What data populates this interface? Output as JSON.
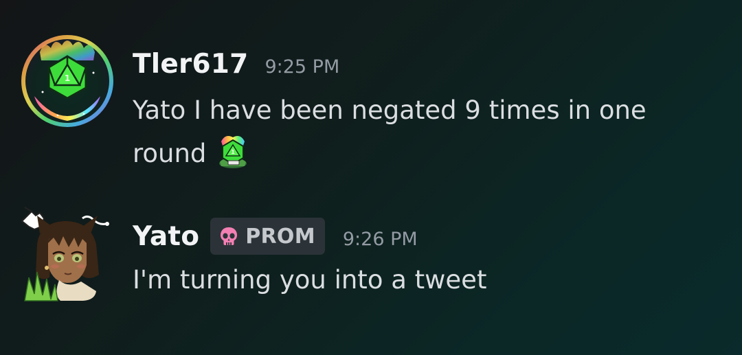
{
  "messages": [
    {
      "author": "Tler617",
      "timestamp": "9:25 PM",
      "text_line1": "Yato I have been negated 9 times in one",
      "text_line2": "round",
      "avatar": "rainbow-d20-dice-avatar",
      "emoji": "rainbow-d20-dice-emoji"
    },
    {
      "author": "Yato",
      "badge": {
        "label": "PROM",
        "icon": "pink-skull-icon",
        "color": "#f47fb3"
      },
      "timestamp": "9:26 PM",
      "text": "I'm turning you into a tweet",
      "avatar": "anime-character-avatar"
    }
  ],
  "colors": {
    "username": "#f2f3f5",
    "timestamp": "#949ba4",
    "message_text": "#dbdee1",
    "badge_background": "#2b3338",
    "background_start": "#131517",
    "background_end": "#0a2a2b"
  }
}
